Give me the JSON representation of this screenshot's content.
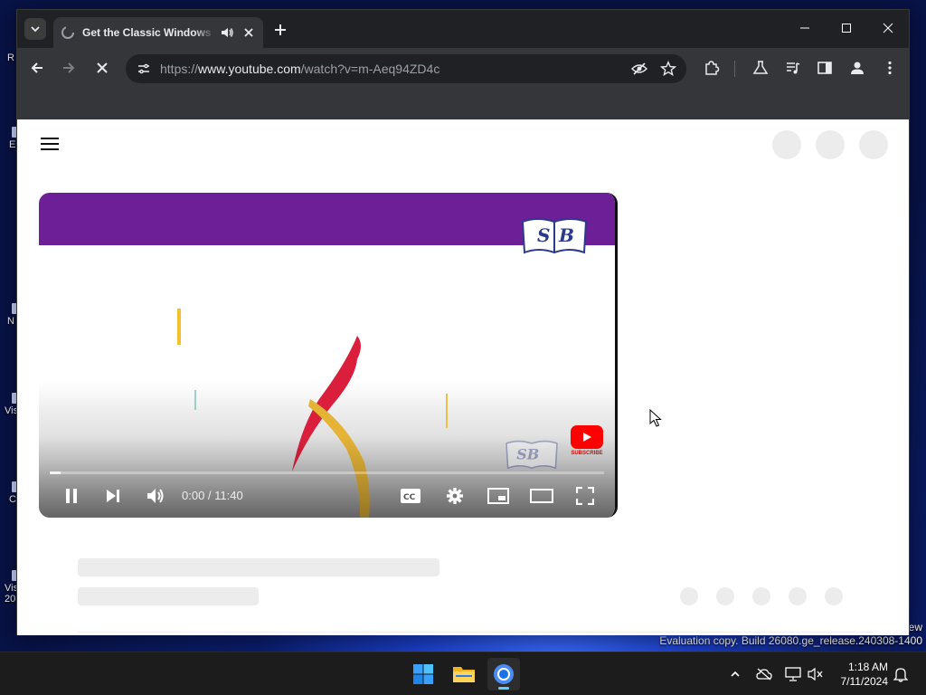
{
  "desktop": {
    "icon_labels": [
      "R",
      "E",
      "N",
      "Vis",
      "C",
      "Vis",
      "20"
    ],
    "watermark_line1": "ew",
    "watermark_line2": "Evaluation copy. Build 26080.ge_release.240308-1400"
  },
  "browser": {
    "tab": {
      "title": "Get the Classic Windows XP",
      "icon": "loading-spinner-icon"
    },
    "address_bar": {
      "scheme": "https://",
      "host": "www.youtube.com",
      "path": "/watch?v=m-Aeq94ZD4c"
    },
    "window_controls": [
      "minimize",
      "maximize",
      "close"
    ]
  },
  "page": {
    "player": {
      "time_current": "0:00",
      "time_separator": " / ",
      "time_total": "11:40",
      "progress": 0.02,
      "subscribe_label": "SUBSCRIBE",
      "header_color": "#6c1f96"
    }
  },
  "taskbar": {
    "apps": [
      "start",
      "file-explorer",
      "chrome"
    ],
    "clock_time": "1:18 AM",
    "clock_date": "7/11/2024"
  }
}
